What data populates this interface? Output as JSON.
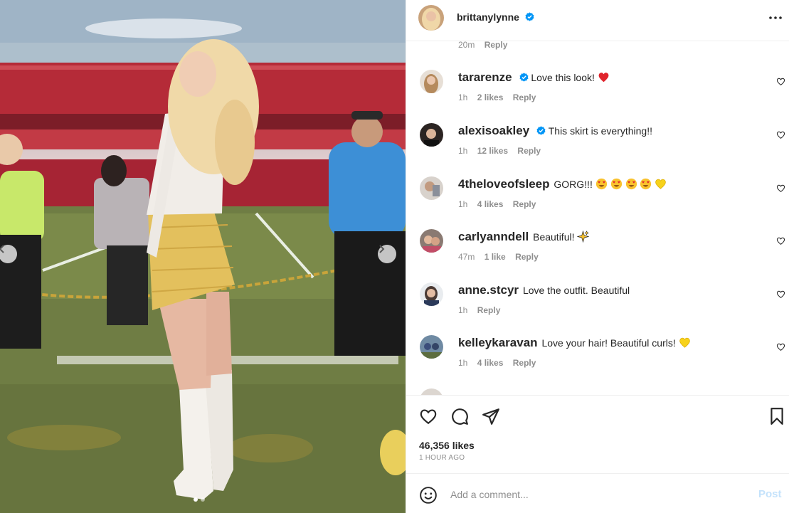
{
  "header": {
    "username": "brittanylynne",
    "verified": true,
    "more_icon": "more-horizontal-icon"
  },
  "top_meta": {
    "time": "20m",
    "reply": "Reply"
  },
  "comments": [
    {
      "user": "tararenze",
      "verified": true,
      "text": "Love this look!",
      "emojis": [
        "red-heart"
      ],
      "time": "1h",
      "likes": "2 likes",
      "reply": "Reply"
    },
    {
      "user": "alexisoakley",
      "verified": true,
      "text": "This skirt is everything!!",
      "emojis": [],
      "time": "1h",
      "likes": "12 likes",
      "reply": "Reply"
    },
    {
      "user": "4theloveofsleep",
      "verified": false,
      "text": "GORG!!!",
      "emojis": [
        "heart-eyes",
        "heart-eyes",
        "heart-eyes",
        "heart-eyes",
        "yellow-heart"
      ],
      "time": "1h",
      "likes": "4 likes",
      "reply": "Reply"
    },
    {
      "user": "carlyanndell",
      "verified": false,
      "text": "Beautiful!",
      "emojis": [
        "sparkles"
      ],
      "time": "47m",
      "likes": "1 like",
      "reply": "Reply"
    },
    {
      "user": "anne.stcyr",
      "verified": false,
      "text": "Love the outfit. Beautiful",
      "emojis": [],
      "time": "1h",
      "likes": "",
      "reply": "Reply"
    },
    {
      "user": "kelleykaravan",
      "verified": false,
      "text": "Love your hair! Beautiful curls!",
      "emojis": [
        "yellow-heart"
      ],
      "time": "1h",
      "likes": "4 likes",
      "reply": "Reply"
    }
  ],
  "actions": {
    "like_icon": "heart-icon",
    "comment_icon": "comment-icon",
    "share_icon": "send-icon",
    "save_icon": "bookmark-icon"
  },
  "stats": {
    "likes": "46,356 likes",
    "time_ago": "1 HOUR AGO"
  },
  "add_comment": {
    "placeholder": "Add a comment...",
    "post_label": "Post"
  },
  "carousel": {
    "current": 1,
    "total": 2
  },
  "colors": {
    "verified": "#0095f6",
    "post_disabled": "#c4e2fb",
    "muted": "#8e8e8e",
    "text": "#262626"
  }
}
